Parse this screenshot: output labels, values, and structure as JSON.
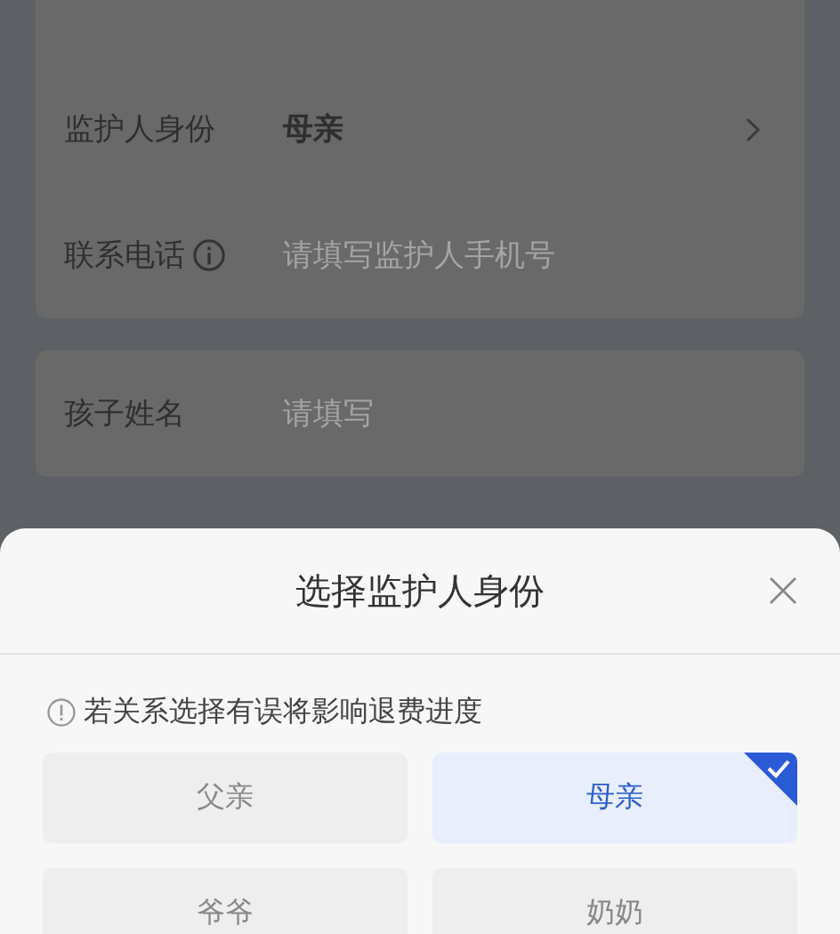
{
  "form_sections": [
    {
      "rows": [
        {
          "label": "监护人身份",
          "kind": "select",
          "value": "母亲",
          "info": false
        },
        {
          "label": "联系电话",
          "kind": "input",
          "placeholder": "请填写监护人手机号",
          "info": true
        }
      ]
    },
    {
      "rows": [
        {
          "label": "孩子姓名",
          "kind": "input",
          "placeholder": "请填写",
          "info": false
        }
      ]
    }
  ],
  "sheet": {
    "title": "选择监护人身份",
    "notice": "若关系选择有误将影响退费进度",
    "options": [
      {
        "label": "父亲",
        "selected": false
      },
      {
        "label": "母亲",
        "selected": true
      },
      {
        "label": "爷爷",
        "selected": false
      },
      {
        "label": "奶奶",
        "selected": false
      }
    ]
  }
}
